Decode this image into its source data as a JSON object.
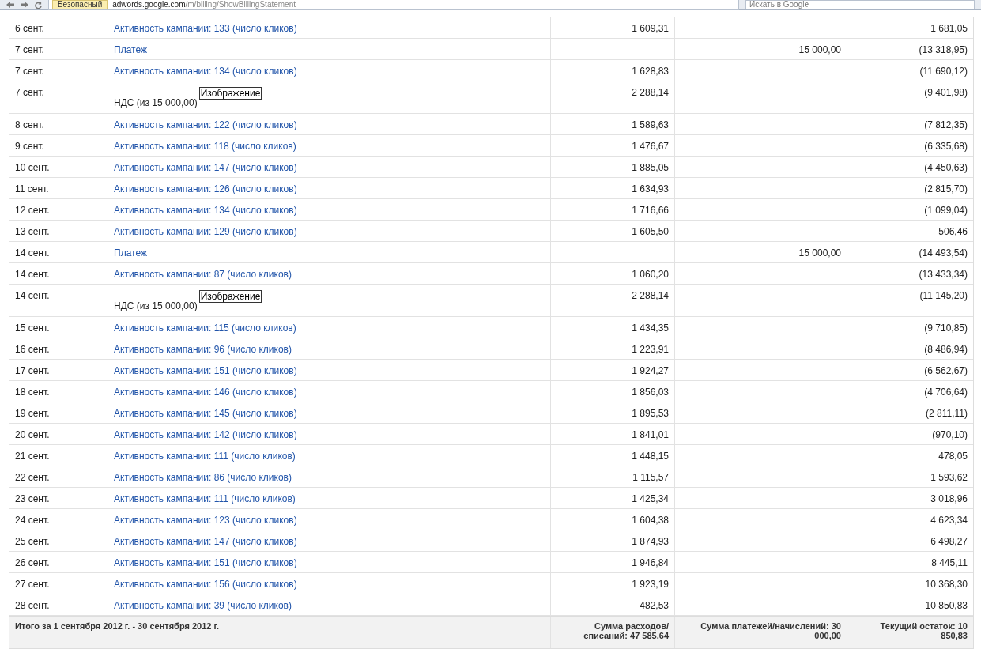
{
  "browser": {
    "security_badge": "Безопасный",
    "url_host": "adwords.google.com",
    "url_path": "/m/billing/ShowBillingStatement",
    "search_placeholder": "Искать в Google"
  },
  "table": {
    "rows": [
      {
        "date": "6 сент.",
        "kind": "link",
        "description": "Активность кампании: 133 (число кликов)",
        "charge": "1 609,31",
        "payment": "",
        "balance": "1 681,05"
      },
      {
        "date": "7 сент.",
        "kind": "link",
        "description": "Платеж",
        "charge": "",
        "payment": "15 000,00",
        "balance": "(13 318,95)"
      },
      {
        "date": "7 сент.",
        "kind": "link",
        "description": "Активность кампании: 134 (число кликов)",
        "charge": "1 628,83",
        "payment": "",
        "balance": "(11 690,12)"
      },
      {
        "date": "7 сент.",
        "kind": "vat",
        "description": "НДС (из 15 000,00)",
        "image_label": "Изображение",
        "charge": "2 288,14",
        "payment": "",
        "balance": "(9 401,98)"
      },
      {
        "date": "8 сент.",
        "kind": "link",
        "description": "Активность кампании: 122 (число кликов)",
        "charge": "1 589,63",
        "payment": "",
        "balance": "(7 812,35)"
      },
      {
        "date": "9 сент.",
        "kind": "link",
        "description": "Активность кампании: 118 (число кликов)",
        "charge": "1 476,67",
        "payment": "",
        "balance": "(6 335,68)"
      },
      {
        "date": "10 сент.",
        "kind": "link",
        "description": "Активность кампании: 147 (число кликов)",
        "charge": "1 885,05",
        "payment": "",
        "balance": "(4 450,63)"
      },
      {
        "date": "11 сент.",
        "kind": "link",
        "description": "Активность кампании: 126 (число кликов)",
        "charge": "1 634,93",
        "payment": "",
        "balance": "(2 815,70)"
      },
      {
        "date": "12 сент.",
        "kind": "link",
        "description": "Активность кампании: 134 (число кликов)",
        "charge": "1 716,66",
        "payment": "",
        "balance": "(1 099,04)"
      },
      {
        "date": "13 сент.",
        "kind": "link",
        "description": "Активность кампании: 129 (число кликов)",
        "charge": "1 605,50",
        "payment": "",
        "balance": "506,46"
      },
      {
        "date": "14 сент.",
        "kind": "link",
        "description": "Платеж",
        "charge": "",
        "payment": "15 000,00",
        "balance": "(14 493,54)"
      },
      {
        "date": "14 сент.",
        "kind": "link",
        "description": "Активность кампании: 87 (число кликов)",
        "charge": "1 060,20",
        "payment": "",
        "balance": "(13 433,34)"
      },
      {
        "date": "14 сент.",
        "kind": "vat",
        "description": "НДС (из 15 000,00)",
        "image_label": "Изображение",
        "charge": "2 288,14",
        "payment": "",
        "balance": "(11 145,20)"
      },
      {
        "date": "15 сент.",
        "kind": "link",
        "description": "Активность кампании: 115 (число кликов)",
        "charge": "1 434,35",
        "payment": "",
        "balance": "(9 710,85)"
      },
      {
        "date": "16 сент.",
        "kind": "link",
        "description": "Активность кампании: 96 (число кликов)",
        "charge": "1 223,91",
        "payment": "",
        "balance": "(8 486,94)"
      },
      {
        "date": "17 сент.",
        "kind": "link",
        "description": "Активность кампании: 151 (число кликов)",
        "charge": "1 924,27",
        "payment": "",
        "balance": "(6 562,67)"
      },
      {
        "date": "18 сент.",
        "kind": "link",
        "description": "Активность кампании: 146 (число кликов)",
        "charge": "1 856,03",
        "payment": "",
        "balance": "(4 706,64)"
      },
      {
        "date": "19 сент.",
        "kind": "link",
        "description": "Активность кампании: 145 (число кликов)",
        "charge": "1 895,53",
        "payment": "",
        "balance": "(2 811,11)"
      },
      {
        "date": "20 сент.",
        "kind": "link",
        "description": "Активность кампании: 142 (число кликов)",
        "charge": "1 841,01",
        "payment": "",
        "balance": "(970,10)"
      },
      {
        "date": "21 сент.",
        "kind": "link",
        "description": "Активность кампании: 111 (число кликов)",
        "charge": "1 448,15",
        "payment": "",
        "balance": "478,05"
      },
      {
        "date": "22 сент.",
        "kind": "link",
        "description": "Активность кампании: 86 (число кликов)",
        "charge": "1 115,57",
        "payment": "",
        "balance": "1 593,62"
      },
      {
        "date": "23 сент.",
        "kind": "link",
        "description": "Активность кампании: 111 (число кликов)",
        "charge": "1 425,34",
        "payment": "",
        "balance": "3 018,96"
      },
      {
        "date": "24 сент.",
        "kind": "link",
        "description": "Активность кампании: 123 (число кликов)",
        "charge": "1 604,38",
        "payment": "",
        "balance": "4 623,34"
      },
      {
        "date": "25 сент.",
        "kind": "link",
        "description": "Активность кампании: 147 (число кликов)",
        "charge": "1 874,93",
        "payment": "",
        "balance": "6 498,27"
      },
      {
        "date": "26 сент.",
        "kind": "link",
        "description": "Активность кампании: 151 (число кликов)",
        "charge": "1 946,84",
        "payment": "",
        "balance": "8 445,11"
      },
      {
        "date": "27 сент.",
        "kind": "link",
        "description": "Активность кампании: 156 (число кликов)",
        "charge": "1 923,19",
        "payment": "",
        "balance": "10 368,30"
      },
      {
        "date": "28 сент.",
        "kind": "link",
        "description": "Активность кампании: 39 (число кликов)",
        "charge": "482,53",
        "payment": "",
        "balance": "10 850,83"
      }
    ],
    "footer": {
      "period": "Итого за 1 сентября 2012 г. - 30 сентября 2012 г.",
      "charges": "Сумма расходов/ списаний: 47 585,64",
      "payments": "Сумма платежей/начислений: 30 000,00",
      "balance": "Текущий остаток: 10 850,83"
    }
  }
}
